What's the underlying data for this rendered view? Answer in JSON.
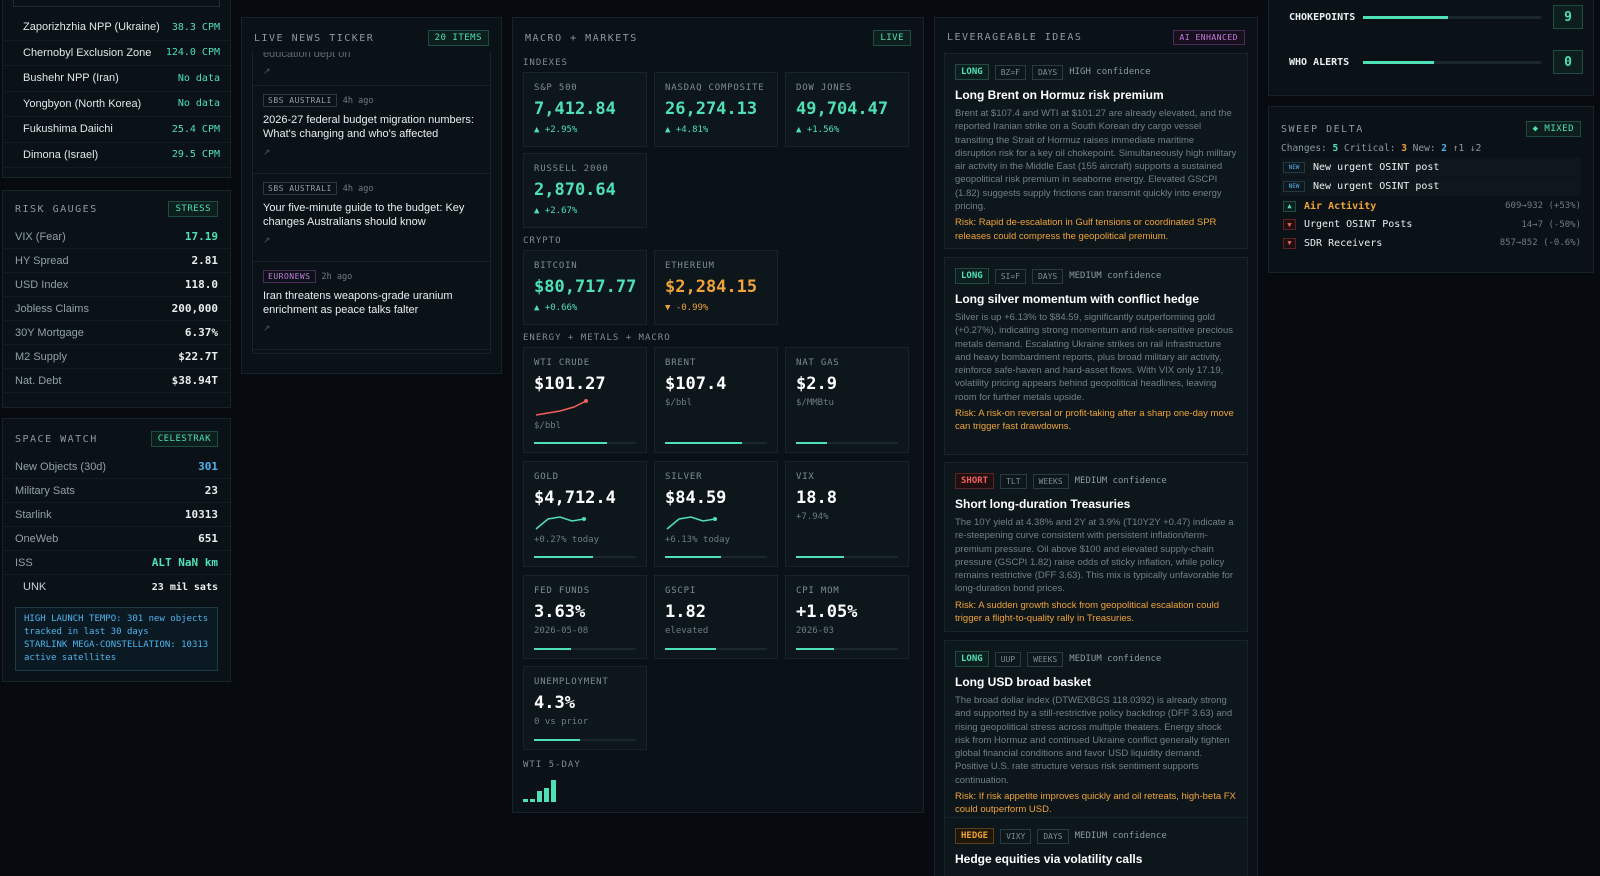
{
  "sites": [
    {
      "name": "Zaporizhzhia NPP (Ukraine)",
      "value": "38.3 CPM",
      "color": "green"
    },
    {
      "name": "Chernobyl Exclusion Zone",
      "value": "124.0 CPM",
      "color": "green"
    },
    {
      "name": "Bushehr NPP (Iran)",
      "value": "No data",
      "color": "green"
    },
    {
      "name": "Yongbyon (North Korea)",
      "value": "No data",
      "color": "green"
    },
    {
      "name": "Fukushima Daiichi",
      "value": "25.4 CPM",
      "color": "green"
    },
    {
      "name": "Dimona (Israel)",
      "value": "29.5 CPM",
      "color": "green"
    }
  ],
  "risk": {
    "title": "RISK GAUGES",
    "badge": "STRESS",
    "rows": [
      {
        "k": "VIX (Fear)",
        "v": "17.19",
        "color": "green"
      },
      {
        "k": "HY Spread",
        "v": "2.81",
        "color": "white"
      },
      {
        "k": "USD Index",
        "v": "118.0",
        "color": "white"
      },
      {
        "k": "Jobless Claims",
        "v": "200,000",
        "color": "white"
      },
      {
        "k": "30Y Mortgage",
        "v": "6.37%",
        "color": "white"
      },
      {
        "k": "M2 Supply",
        "v": "$22.7T",
        "color": "white"
      },
      {
        "k": "Nat. Debt",
        "v": "$38.94T",
        "color": "white"
      }
    ]
  },
  "space": {
    "title": "SPACE WATCH",
    "badge": "CELESTRAK",
    "rows": [
      {
        "k": "New Objects (30d)",
        "v": "301",
        "color": "blue"
      },
      {
        "k": "Military Sats",
        "v": "23",
        "color": "white"
      },
      {
        "k": "Starlink",
        "v": "10313",
        "color": "white"
      },
      {
        "k": "OneWeb",
        "v": "651",
        "color": "white"
      },
      {
        "k": "ISS",
        "v": "ALT NaN km",
        "color": "green"
      },
      {
        "k": "UNK",
        "v": "23 mil sats",
        "color": "white"
      }
    ],
    "alert": "HIGH LAUNCH TEMPO: 301 new objects tracked in last 30 days\nSTARLINK MEGA-CONSTELLATION: 10313 active satellites"
  },
  "news": {
    "title": "LIVE NEWS TICKER",
    "badge": "20 ITEMS",
    "partial": "education dept on",
    "items": [
      {
        "source": "SBS AUSTRALI",
        "time": "4h ago",
        "headline": "2026-27 federal budget migration numbers: What's changing and who's affected",
        "euro": false
      },
      {
        "source": "SBS AUSTRALI",
        "time": "4h ago",
        "headline": "Your five-minute guide to the budget: Key changes Australians should know",
        "euro": false
      },
      {
        "source": "EURONEWS",
        "time": "2h ago",
        "headline": "Iran threatens weapons-grade uranium enrichment as peace talks falter",
        "euro": true
      }
    ]
  },
  "macro": {
    "title": "MACRO + MARKETS",
    "badge": "LIVE",
    "sections": {
      "indexes": "INDEXES",
      "crypto": "CRYPTO",
      "energy": "ENERGY + METALS + MACRO",
      "wti5": "WTI 5-DAY"
    },
    "indexes": [
      {
        "label": "S&P 500",
        "value": "7,412.84",
        "change": "▲ +2.95%"
      },
      {
        "label": "NASDAQ COMPOSITE",
        "value": "26,274.13",
        "change": "▲ +4.81%"
      },
      {
        "label": "DOW JONES",
        "value": "49,704.47",
        "change": "▲ +1.56%"
      },
      {
        "label": "RUSSELL 2000",
        "value": "2,870.64",
        "change": "▲ +2.67%"
      }
    ],
    "crypto": [
      {
        "label": "BITCOIN",
        "value": "$80,717.77",
        "change": "▲ +0.66%",
        "up": true
      },
      {
        "label": "ETHEREUM",
        "value": "$2,284.15",
        "change": "▼ -0.99%",
        "up": false
      }
    ],
    "energy": [
      {
        "label": "WTI CRUDE",
        "value": "$101.27",
        "sub": "$/bbl",
        "fill": 0.72,
        "spark": "red"
      },
      {
        "label": "BRENT",
        "value": "$107.4",
        "sub": "$/bbl",
        "fill": 0.75,
        "spark": ""
      },
      {
        "label": "NAT GAS",
        "value": "$2.9",
        "sub": "$/MMBtu",
        "fill": 0.3,
        "spark": ""
      },
      {
        "label": "GOLD",
        "value": "$4,712.4",
        "sub": "+0.27% today",
        "fill": 0.58,
        "spark": "green"
      },
      {
        "label": "SILVER",
        "value": "$84.59",
        "sub": "+6.13% today",
        "fill": 0.55,
        "spark": "green"
      },
      {
        "label": "VIX",
        "value": "18.8",
        "sub": "+7.94%",
        "fill": 0.47,
        "spark": ""
      },
      {
        "label": "FED FUNDS",
        "value": "3.63%",
        "sub": "2026-05-08",
        "fill": 0.36,
        "spark": ""
      },
      {
        "label": "GSCPI",
        "value": "1.82",
        "sub": "elevated",
        "fill": 0.5,
        "spark": ""
      },
      {
        "label": "CPI MOM",
        "value": "+1.05%",
        "sub": "2026-03",
        "fill": 0.37,
        "spark": ""
      },
      {
        "label": "UNEMPLOYMENT",
        "value": "4.3%",
        "sub": "0 vs prior",
        "fill": 0.45,
        "spark": ""
      }
    ],
    "wti_bars": [
      0.15,
      0.15,
      0.5,
      0.65,
      1.0
    ]
  },
  "ideas": {
    "title": "LEVERAGEABLE IDEAS",
    "badge": "AI ENHANCED",
    "items": [
      {
        "dir": "LONG",
        "ticker": "BZ=F",
        "horizon": "DAYS",
        "confidence": "HIGH confidence",
        "title": "Long Brent on Hormuz risk premium",
        "body": "Brent at $107.4 and WTI at $101.27 are already elevated, and the reported Iranian strike on a South Korean dry cargo vessel transiting the Strait of Hormuz raises immediate maritime disruption risk for a key oil chokepoint. Simultaneously high military air activity in the Middle East (155 aircraft) supports a sustained geopolitical risk premium in seaborne energy. Elevated GSCPI (1.82) suggests supply frictions can transmit quickly into energy pricing.",
        "risk": "Risk: Rapid de-escalation in Gulf tensions or coordinated SPR releases could compress the geopolitical premium."
      },
      {
        "dir": "LONG",
        "ticker": "SI=F",
        "horizon": "DAYS",
        "confidence": "MEDIUM confidence",
        "title": "Long silver momentum with conflict hedge",
        "body": "Silver is up +6.13% to $84.59, significantly outperforming gold (+0.27%), indicating strong momentum and risk-sensitive precious metals demand. Escalating Ukraine strikes on rail infrastructure and heavy bombardment reports, plus broad military air activity, reinforce safe-haven and hard-asset flows. With VIX only 17.19, volatility pricing appears behind geopolitical headlines, leaving room for further metals upside.",
        "risk": "Risk: A risk-on reversal or profit-taking after a sharp one-day move can trigger fast drawdowns."
      },
      {
        "dir": "SHORT",
        "ticker": "TLT",
        "horizon": "WEEKS",
        "confidence": "MEDIUM confidence",
        "title": "Short long-duration Treasuries",
        "body": "The 10Y yield at 4.38% and 2Y at 3.9% (T10Y2Y +0.47) indicate a re-steepening curve consistent with persistent inflation/term-premium pressure. Oil above $100 and elevated supply-chain pressure (GSCPI 1.82) raise odds of sticky inflation, while policy remains restrictive (DFF 3.63). This mix is typically unfavorable for long-duration bond prices.",
        "risk": "Risk: A sudden growth shock from geopolitical escalation could trigger a flight-to-quality rally in Treasuries."
      },
      {
        "dir": "LONG",
        "ticker": "UUP",
        "horizon": "WEEKS",
        "confidence": "MEDIUM confidence",
        "title": "Long USD broad basket",
        "body": "The broad dollar index (DTWEXBGS 118.0392) is already strong and supported by a still-restrictive policy backdrop (DFF 3.63) and rising geopolitical stress across multiple theaters. Energy shock risk from Hormuz and continued Ukraine conflict generally tighten global financial conditions and favor USD liquidity demand. Positive U.S. rate structure versus risk sentiment supports continuation.",
        "risk": "Risk: If risk appetite improves quickly and oil retreats, high-beta FX could outperform USD."
      },
      {
        "dir": "HEDGE",
        "ticker": "VIXY",
        "horizon": "DAYS",
        "confidence": "MEDIUM confidence",
        "title": "Hedge equities via volatility calls",
        "body": "",
        "risk": ""
      }
    ]
  },
  "gauges": [
    {
      "label": "CHOKEPOINTS",
      "value": "9",
      "fill": 0.48
    },
    {
      "label": "WHO ALERTS",
      "value": "0",
      "fill": 0.4
    }
  ],
  "sweep": {
    "title": "SWEEP DELTA",
    "badge": "◆ MIXED",
    "changes_label": "Changes:",
    "changes": "5",
    "critical_label": "Critical:",
    "critical": "3",
    "new_label": "New:",
    "new": "2",
    "arrows": "↑1 ↓2",
    "rows": [
      {
        "mark": "NEW",
        "label": "New urgent OSINT post",
        "value": "",
        "kind": "new"
      },
      {
        "mark": "NEW",
        "label": "New urgent OSINT post",
        "value": "",
        "kind": "new"
      },
      {
        "mark": "▲",
        "label": "Air Activity",
        "value": "609→932 (+53%)",
        "kind": "up"
      },
      {
        "mark": "▼",
        "label": "Urgent OSINT Posts",
        "value": "14→7 (-50%)",
        "kind": "down"
      },
      {
        "mark": "▼",
        "label": "SDR Receivers",
        "value": "857→852 (-0.6%)",
        "kind": "down"
      }
    ]
  }
}
